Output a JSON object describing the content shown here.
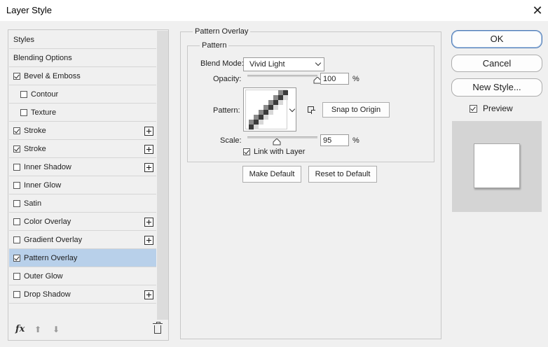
{
  "window": {
    "title": "Layer Style",
    "close_glyph": "✕"
  },
  "styles_list": {
    "items": [
      {
        "label": "Styles",
        "has_checkbox": false,
        "checked": false,
        "has_plus": false,
        "selected": false,
        "indent": false
      },
      {
        "label": "Blending Options",
        "has_checkbox": false,
        "checked": false,
        "has_plus": false,
        "selected": false,
        "indent": false
      },
      {
        "label": "Bevel & Emboss",
        "has_checkbox": true,
        "checked": true,
        "has_plus": false,
        "selected": false,
        "indent": false
      },
      {
        "label": "Contour",
        "has_checkbox": true,
        "checked": false,
        "has_plus": false,
        "selected": false,
        "indent": true
      },
      {
        "label": "Texture",
        "has_checkbox": true,
        "checked": false,
        "has_plus": false,
        "selected": false,
        "indent": true
      },
      {
        "label": "Stroke",
        "has_checkbox": true,
        "checked": true,
        "has_plus": true,
        "selected": false,
        "indent": false
      },
      {
        "label": "Stroke",
        "has_checkbox": true,
        "checked": true,
        "has_plus": true,
        "selected": false,
        "indent": false
      },
      {
        "label": "Inner Shadow",
        "has_checkbox": true,
        "checked": false,
        "has_plus": true,
        "selected": false,
        "indent": false
      },
      {
        "label": "Inner Glow",
        "has_checkbox": true,
        "checked": false,
        "has_plus": false,
        "selected": false,
        "indent": false
      },
      {
        "label": "Satin",
        "has_checkbox": true,
        "checked": false,
        "has_plus": false,
        "selected": false,
        "indent": false
      },
      {
        "label": "Color Overlay",
        "has_checkbox": true,
        "checked": false,
        "has_plus": true,
        "selected": false,
        "indent": false
      },
      {
        "label": "Gradient Overlay",
        "has_checkbox": true,
        "checked": false,
        "has_plus": true,
        "selected": false,
        "indent": false
      },
      {
        "label": "Pattern Overlay",
        "has_checkbox": true,
        "checked": true,
        "has_plus": false,
        "selected": true,
        "indent": false
      },
      {
        "label": "Outer Glow",
        "has_checkbox": true,
        "checked": false,
        "has_plus": false,
        "selected": false,
        "indent": false
      },
      {
        "label": "Drop Shadow",
        "has_checkbox": true,
        "checked": false,
        "has_plus": true,
        "selected": false,
        "indent": false
      }
    ],
    "footer": {
      "fx_label": "fx",
      "move_up_glyph": "⬆",
      "move_down_glyph": "⬇",
      "delete_icon": "trash-icon"
    }
  },
  "pattern_overlay": {
    "group_title": "Pattern Overlay",
    "pattern_group_title": "Pattern",
    "blend_mode_label": "Blend Mode:",
    "blend_mode_value": "Vivid Light",
    "opacity_label": "Opacity:",
    "opacity_value": "100",
    "opacity_fraction": 1.0,
    "percent_sign": "%",
    "pattern_label": "Pattern:",
    "snap_to_origin": "Snap to Origin",
    "scale_label": "Scale:",
    "scale_value": "95",
    "scale_fraction": 0.42,
    "link_with_layer_label": "Link with Layer",
    "link_with_layer_checked": true,
    "make_default": "Make Default",
    "reset_to_default": "Reset to Default"
  },
  "actions": {
    "ok": "OK",
    "cancel": "Cancel",
    "new_style": "New Style...",
    "preview_label": "Preview",
    "preview_checked": true
  },
  "colors": {
    "selected_row": "#b8d0ea",
    "dialog_bg": "#f0f0f0",
    "preview_bg": "#d4d4d4",
    "pattern_dark": "#3a3a3a",
    "pattern_mid": "#8a8a8a",
    "pattern_light": "#d8d8d8"
  }
}
